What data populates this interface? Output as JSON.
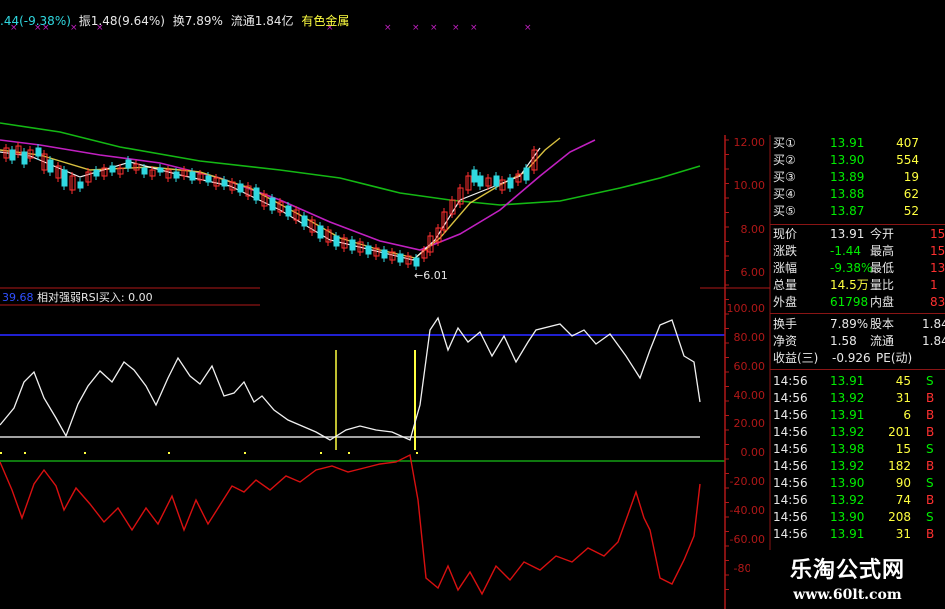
{
  "header": {
    "change_text": ".44(-9.38%)",
    "amplitude_label": "振",
    "amplitude_value": "1.48(9.64%)",
    "turnover_label": "换",
    "turnover_value": "7.89%",
    "float_label": "流通",
    "float_value": "1.84亿",
    "sector": "有色金属"
  },
  "rsi_panel": {
    "left_value": "39.68",
    "label": "相对强弱RSI买入",
    "value": ": 0.00"
  },
  "price_axis": [
    "12.00",
    "10.00",
    "8.00",
    "6.00"
  ],
  "low_marker": "←6.01",
  "rsi_axis": [
    "100.00",
    "80.00",
    "60.00",
    "40.00",
    "20.00",
    "0.00",
    "-20.00",
    "-40.00",
    "-60.00",
    "-80."
  ],
  "order_book": [
    {
      "label": "买①",
      "price": "13.91",
      "vol": "407"
    },
    {
      "label": "买②",
      "price": "13.90",
      "vol": "554"
    },
    {
      "label": "买③",
      "price": "13.89",
      "vol": "19"
    },
    {
      "label": "买④",
      "price": "13.88",
      "vol": "62"
    },
    {
      "label": "买⑤",
      "price": "13.87",
      "vol": "52"
    }
  ],
  "quote_rows": [
    {
      "l1": "现价",
      "v1": "13.91",
      "l2": "今开",
      "v2": "15"
    },
    {
      "l1": "涨跌",
      "v1": "-1.44",
      "l2": "最高",
      "v2": "15"
    },
    {
      "l1": "涨幅",
      "v1": "-9.38%",
      "l2": "最低",
      "v2": "13"
    },
    {
      "l1": "总量",
      "v1": "14.5万",
      "l2": "量比",
      "v2": "1"
    },
    {
      "l1": "外盘",
      "v1": "61798",
      "l2": "内盘",
      "v2": "833"
    }
  ],
  "stats_rows": [
    {
      "l1": "换手",
      "v1": "7.89%",
      "l2": "股本",
      "v2": "1.84"
    },
    {
      "l1": "净资",
      "v1": "1.58",
      "l2": "流通",
      "v2": "1.84"
    },
    {
      "l1": "收益(三)",
      "v1": "-0.926",
      "l2": "PE(动)",
      "v2": ""
    }
  ],
  "trades": [
    {
      "time": "14:56",
      "price": "13.91",
      "vol": "45",
      "side": "S"
    },
    {
      "time": "14:56",
      "price": "13.92",
      "vol": "31",
      "side": "B"
    },
    {
      "time": "14:56",
      "price": "13.91",
      "vol": "6",
      "side": "B"
    },
    {
      "time": "14:56",
      "price": "13.92",
      "vol": "201",
      "side": "B"
    },
    {
      "time": "14:56",
      "price": "13.98",
      "vol": "15",
      "side": "S"
    },
    {
      "time": "14:56",
      "price": "13.92",
      "vol": "182",
      "side": "B"
    },
    {
      "time": "14:56",
      "price": "13.90",
      "vol": "90",
      "side": "S"
    },
    {
      "time": "14:56",
      "price": "13.92",
      "vol": "74",
      "side": "B"
    },
    {
      "time": "14:56",
      "price": "13.90",
      "vol": "208",
      "side": "S"
    },
    {
      "time": "14:56",
      "price": "13.91",
      "vol": "31",
      "side": "B"
    }
  ],
  "watermark": {
    "brand": "乐淘公式网",
    "url": "www.60lt.com"
  },
  "colors": {
    "up": "#ff3030",
    "down": "#30d8e0",
    "green_val": "#00ee00",
    "yellow": "#ffff40",
    "label_white": "#e8e8e8",
    "axis_red": "#b01818",
    "ma_green": "#14b814",
    "ma_magenta": "#c020c0",
    "ma_yellow": "#d8c040",
    "ma_white": "#f0f0f0",
    "rsi_line": "#f0f0f0",
    "osc_line": "#d81010",
    "blue_line": "#2020d0"
  }
}
